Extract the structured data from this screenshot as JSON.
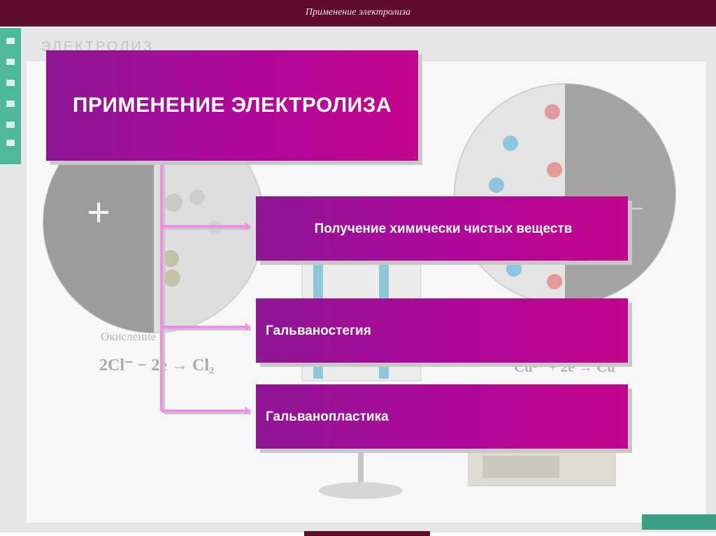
{
  "header": {
    "title": "Применение электролиза"
  },
  "main": {
    "title": "ПРИМЕНЕНИЕ ЭЛЕКТРОЛИЗА",
    "items": [
      {
        "label": "Получение химически чистых веществ"
      },
      {
        "label": "Гальваностегия"
      },
      {
        "label": "Гальванопластика"
      }
    ]
  },
  "background": {
    "heading": "ЭЛЕКТРОЛИЗ",
    "anode_sign": "+",
    "cathode_sign": "−",
    "anode_label": "Окисление",
    "anode_equation": "2Cl⁻ − 2e → Cl₂",
    "cathode_equation": "Cu²⁺ + 2e → Cu"
  },
  "colors": {
    "header_bg": "#5e0b2c",
    "box_gradient_start": "#8e1694",
    "box_gradient_end": "#c2068d",
    "connector": "#f48ce6"
  }
}
